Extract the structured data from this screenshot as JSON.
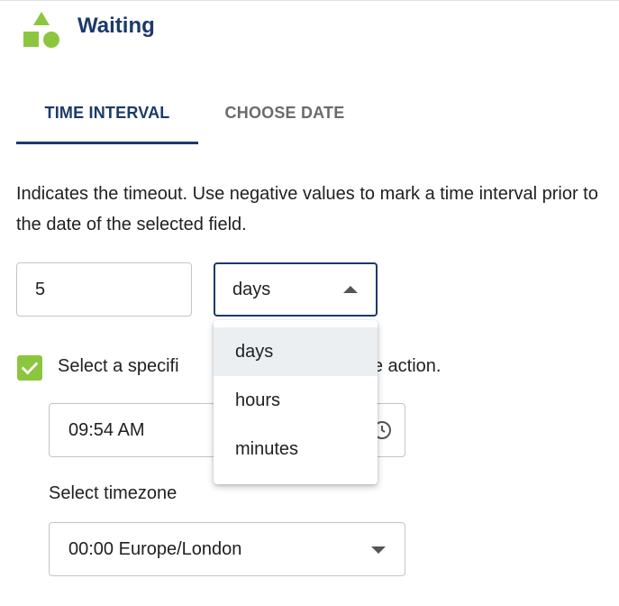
{
  "header": {
    "title": "Waiting",
    "icon": "shapes-icon",
    "icon_color": "#8cc63f"
  },
  "tabs": [
    {
      "label": "TIME INTERVAL",
      "active": true
    },
    {
      "label": "CHOOSE DATE",
      "active": false
    }
  ],
  "description": "Indicates the timeout. Use negative values to mark a time interval prior to the date of the selected field.",
  "interval": {
    "value": "5",
    "unit": "days",
    "unit_options": [
      "days",
      "hours",
      "minutes"
    ],
    "selected_option": "days"
  },
  "specific_time": {
    "checked": true,
    "label_visible_left": "Select a specifi",
    "label_visible_right": "e the action.",
    "time_value": "09:54 AM"
  },
  "timezone": {
    "label": "Select timezone",
    "value": "00:00 Europe/London"
  },
  "colors": {
    "primary": "#1b3a6b",
    "accent_green": "#8cc63f",
    "tab_inactive": "#6b6b6b",
    "border": "#c4c4c4",
    "option_selected_bg": "#eceff1"
  }
}
